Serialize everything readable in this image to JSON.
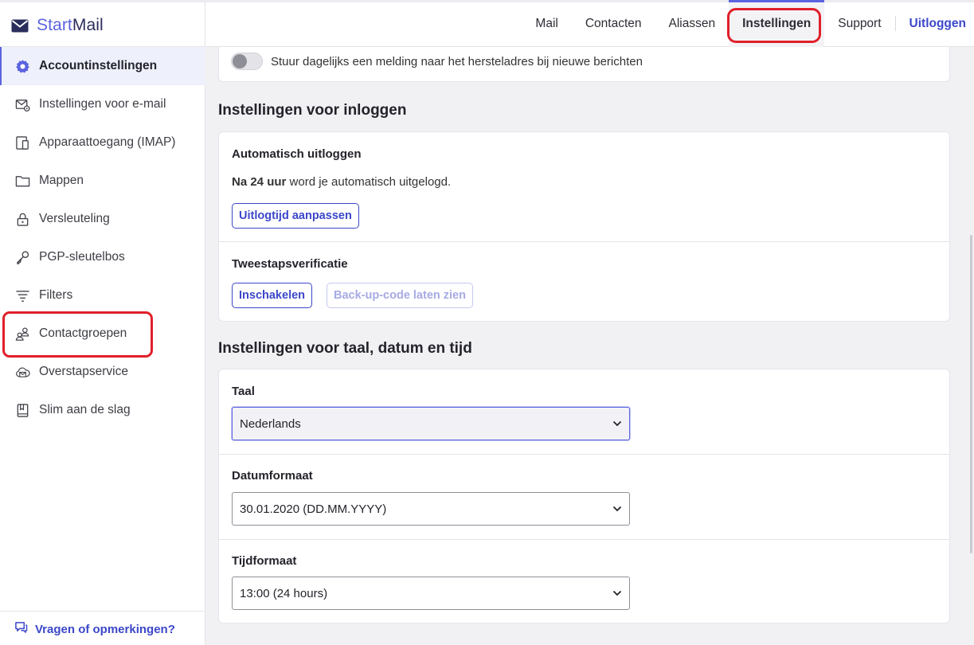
{
  "brand": {
    "start": "Start",
    "mail": "Mail"
  },
  "sidebar": {
    "items": [
      {
        "label": "Accountinstellingen",
        "icon": "gear-icon",
        "active": true
      },
      {
        "label": "Instellingen voor e-mail",
        "icon": "mail-settings-icon"
      },
      {
        "label": "Apparaattoegang (IMAP)",
        "icon": "device-icon"
      },
      {
        "label": "Mappen",
        "icon": "folder-icon"
      },
      {
        "label": "Versleuteling",
        "icon": "lock-icon"
      },
      {
        "label": "PGP-sleutelbos",
        "icon": "key-icon"
      },
      {
        "label": "Filters",
        "icon": "filter-icon"
      },
      {
        "label": "Contactgroepen",
        "icon": "contact-group-icon"
      },
      {
        "label": "Overstapservice",
        "icon": "cloud-transfer-icon"
      },
      {
        "label": "Slim aan de slag",
        "icon": "book-icon"
      }
    ],
    "feedback": "Vragen of opmerkingen?"
  },
  "topnav": {
    "mail": "Mail",
    "contacts": "Contacten",
    "aliases": "Aliassen",
    "settings": "Instellingen",
    "support": "Support",
    "logout": "Uitloggen"
  },
  "notification": {
    "toggle_label": "Stuur dagelijks een melding naar het hersteladres bij nieuwe berichten",
    "enabled": false
  },
  "login_settings": {
    "title": "Instellingen voor inloggen",
    "auto_logout": {
      "title": "Automatisch uitloggen",
      "bold": "Na 24 uur",
      "text": " word je automatisch uitgelogd.",
      "button": "Uitlogtijd aanpassen"
    },
    "two_factor": {
      "title": "Tweestapsverificatie",
      "enable_button": "Inschakelen",
      "backup_button": "Back-up-code laten zien"
    }
  },
  "locale_settings": {
    "title": "Instellingen voor taal, datum en tijd",
    "language": {
      "label": "Taal",
      "value": "Nederlands"
    },
    "date_format": {
      "label": "Datumformaat",
      "value": "30.01.2020 (DD.MM.YYYY)"
    },
    "time_format": {
      "label": "Tijdformaat",
      "value": "13:00 (24 hours)"
    }
  },
  "colors": {
    "accent": "#5b63e0",
    "link": "#3b47c9",
    "highlight": "#e0202a"
  }
}
